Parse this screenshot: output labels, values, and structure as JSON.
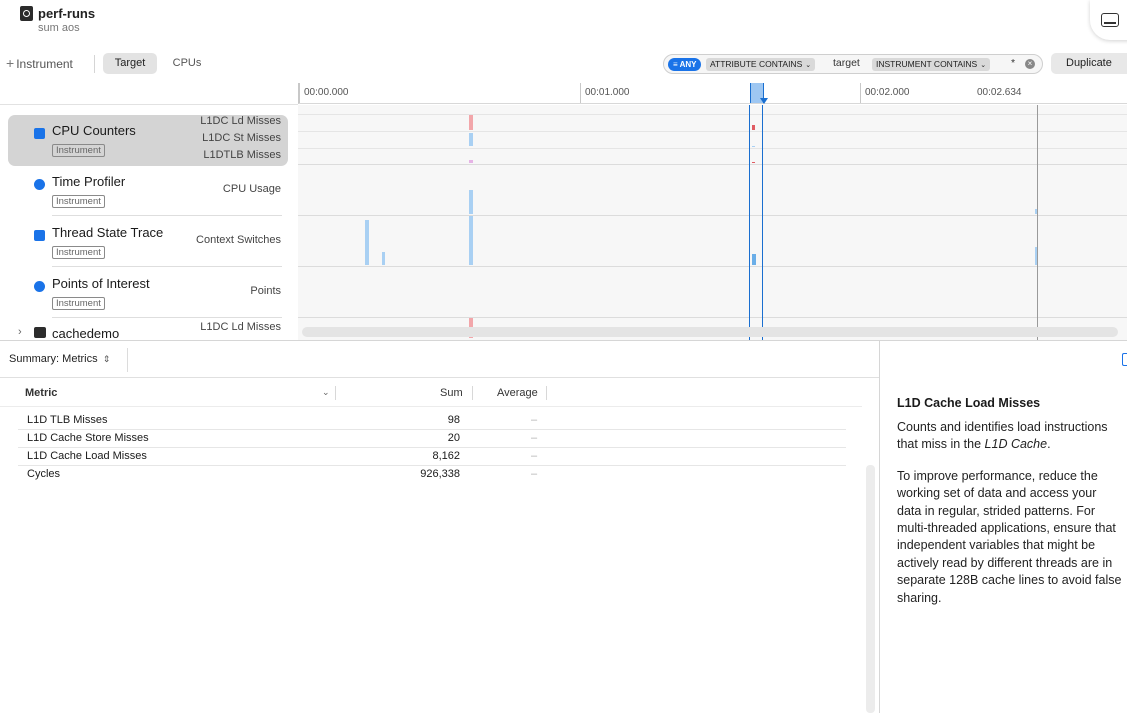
{
  "window": {
    "title": "perf-runs",
    "subtitle": "sum aos",
    "icon": "document-icon",
    "corner_icon": "panel-toggle-icon"
  },
  "toolbar": {
    "add_instrument_label": "Instrument",
    "tabs": [
      {
        "label": "Target",
        "selected": true
      },
      {
        "label": "CPUs",
        "selected": false
      }
    ],
    "filter": {
      "any_label": "ANY",
      "token1": "ATTRIBUTE CONTAINS",
      "value1": "target",
      "token2": "INSTRUMENT CONTAINS",
      "value2": "*"
    },
    "duplicate_label": "Duplicate"
  },
  "timeline": {
    "ticks": [
      "00:00.000",
      "00:01.000",
      "00:02.000",
      "00:02.634"
    ]
  },
  "tracks": [
    {
      "name": "CPU Counters",
      "badge": "Instrument",
      "icon": "cpu-counters-icon",
      "metrics": [
        "L1DC Ld Misses",
        "L1DC St Misses",
        "L1DTLB Misses"
      ],
      "selected": true
    },
    {
      "name": "Time Profiler",
      "badge": "Instrument",
      "icon": "time-profiler-icon",
      "metrics": [
        "CPU Usage"
      ],
      "selected": false
    },
    {
      "name": "Thread State Trace",
      "badge": "Instrument",
      "icon": "thread-state-icon",
      "metrics": [
        "Context Switches"
      ],
      "selected": false
    },
    {
      "name": "Points of Interest",
      "badge": "Instrument",
      "icon": "points-of-interest-icon",
      "metrics": [
        "Points"
      ],
      "selected": false
    },
    {
      "name": "cachedemo",
      "badge": "",
      "icon": "terminal-icon",
      "metrics": [
        "L1DC Ld Misses"
      ],
      "selected": false
    }
  ],
  "summary": {
    "selector_label": "Summary: Metrics",
    "columns": [
      "Metric",
      "Sum",
      "Average"
    ],
    "rows": [
      {
        "metric": "L1D TLB Misses",
        "sum": "98",
        "avg": "–"
      },
      {
        "metric": "L1D Cache Store Misses",
        "sum": "20",
        "avg": "–"
      },
      {
        "metric": "L1D Cache Load Misses",
        "sum": "8,162",
        "avg": "–"
      },
      {
        "metric": "Cycles",
        "sum": "926,338",
        "avg": "–"
      }
    ]
  },
  "inspector": {
    "title": "L1D Cache Load Misses",
    "para1_pre": "Counts and identifies load instructions that miss in the ",
    "para1_em": "L1D Cache",
    "para1_post": ".",
    "para2": "To improve performance, reduce the working set of data and access your data in regular, strided patterns. For multi-threaded applications, ensure that independent variables that might be actively read by different threads are in separate 128B cache lines to avoid false sharing."
  },
  "colors": {
    "accent": "#1a73e8",
    "miss_red": "#f2a6aa",
    "bar_blue": "#a9d0f3",
    "pink": "#e6b3e6"
  }
}
